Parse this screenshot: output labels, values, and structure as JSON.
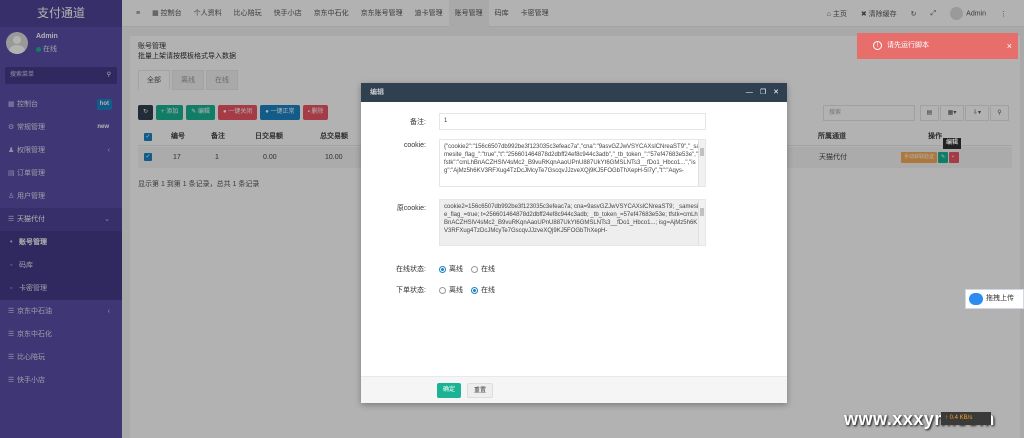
{
  "sidebar": {
    "brand": "支付通道",
    "user_name": "Admin",
    "user_status": "在线",
    "search": "搜索菜单",
    "items": [
      {
        "label": "控制台",
        "badge": "hot"
      },
      {
        "label": "常规管理",
        "badge": "new"
      },
      {
        "label": "权限管理",
        "chevron": "‹"
      },
      {
        "label": "订单管理"
      },
      {
        "label": "用户管理"
      },
      {
        "label": "天猫代付",
        "chevron": "⌄"
      },
      {
        "label": "账号管理"
      },
      {
        "label": "码库"
      },
      {
        "label": "卡密管理"
      },
      {
        "label": "京东中石油",
        "chevron": "‹"
      },
      {
        "label": "京东中石化"
      },
      {
        "label": "比心陪玩"
      },
      {
        "label": "快手小店"
      }
    ]
  },
  "topnav": [
    "控制台",
    "个人资料",
    "比心陪玩",
    "快手小店",
    "京东中石化",
    "京东账号管理",
    "迪卡管理",
    "账号管理",
    "码库",
    "卡密管理"
  ],
  "topright": {
    "home": "主页",
    "clear": "清除缓存",
    "user": "Admin"
  },
  "page": {
    "title": "账号管理",
    "subtitle": "批量上架请按模板格式导入数据",
    "tabs": [
      "全部",
      "离线",
      "在线"
    ],
    "toolbar": [
      "添加",
      "编辑",
      "一键关闭",
      "一键正常",
      "删除"
    ],
    "search_placeholder": "搜索",
    "table": {
      "headers": [
        "编号",
        "备注",
        "日交易额",
        "总交易额",
        "所属通道",
        "操作"
      ],
      "row": {
        "id": "17",
        "note": "1",
        "daily": "0.00",
        "total": "10.00",
        "channel": "天猫代付",
        "op_label": "手动获取验证"
      }
    },
    "tooltip": "编辑",
    "pagination": "显示第 1 到第 1 条记录，总共 1 条记录"
  },
  "toast": {
    "text": "请先运行脚本"
  },
  "modal": {
    "title": "编辑",
    "labels": {
      "note": "备注:",
      "cookie": "cookie:",
      "orig_cookie": "原cookie:",
      "online": "在线状态:",
      "order": "下单状态:"
    },
    "note_value": "1",
    "cookie_value": "{\"cookie2\":\"156c6507db992be3f123035c3efeac7a\",\"cna\":\"9asvGZJwVSYCAXslCNreaST9\",\"_samesite_flag_\":\"true\",\"t\":\"256601464878d2dbff24ef8c944c3adb\",\"_tb_token_\":\"57ef47683e53e\",\"tfstk\":\"cmLhBnACZHSlV4sMc2_B9vuRKqnAaoUPnU887UkYt6GMSLNTs3__fDo1_Hbco1...\",\"isg\":\"AjMz5h6KV3RFXug4TzDcJMcyTe7GscqvJJzveXQj9KJ5FOGbThXepH-5l7y\",\"t\":\"Aqys-",
    "orig_cookie_value": "cookie2=156c6507db992be3f123035c3efeac7a; cna=9asvGZJwVSYCAXslCNreaST9; _samesite_flag_=true; t=256601464878d2dbff24ef8c944c3adb; _tb_token_=57ef47683e53e; tfstk=cmLhBnACZHSlV4sMc2_B9vuRKqnAaoUPnU887UkYt6GMSLNTs3__fDo1_Hbco1...; isg=AjMz5h6KV3RFXug4TzDcJMcyTe7GscqvJJzveXQj9KJ5FOGbThXepH-",
    "radio": {
      "offline": "离线",
      "online": "在线"
    },
    "ok": "确定",
    "reset": "重置"
  },
  "upload": "拖拽上传",
  "speed": "↑ 0.4 KB/s",
  "watermark": "www.xxxym.com"
}
